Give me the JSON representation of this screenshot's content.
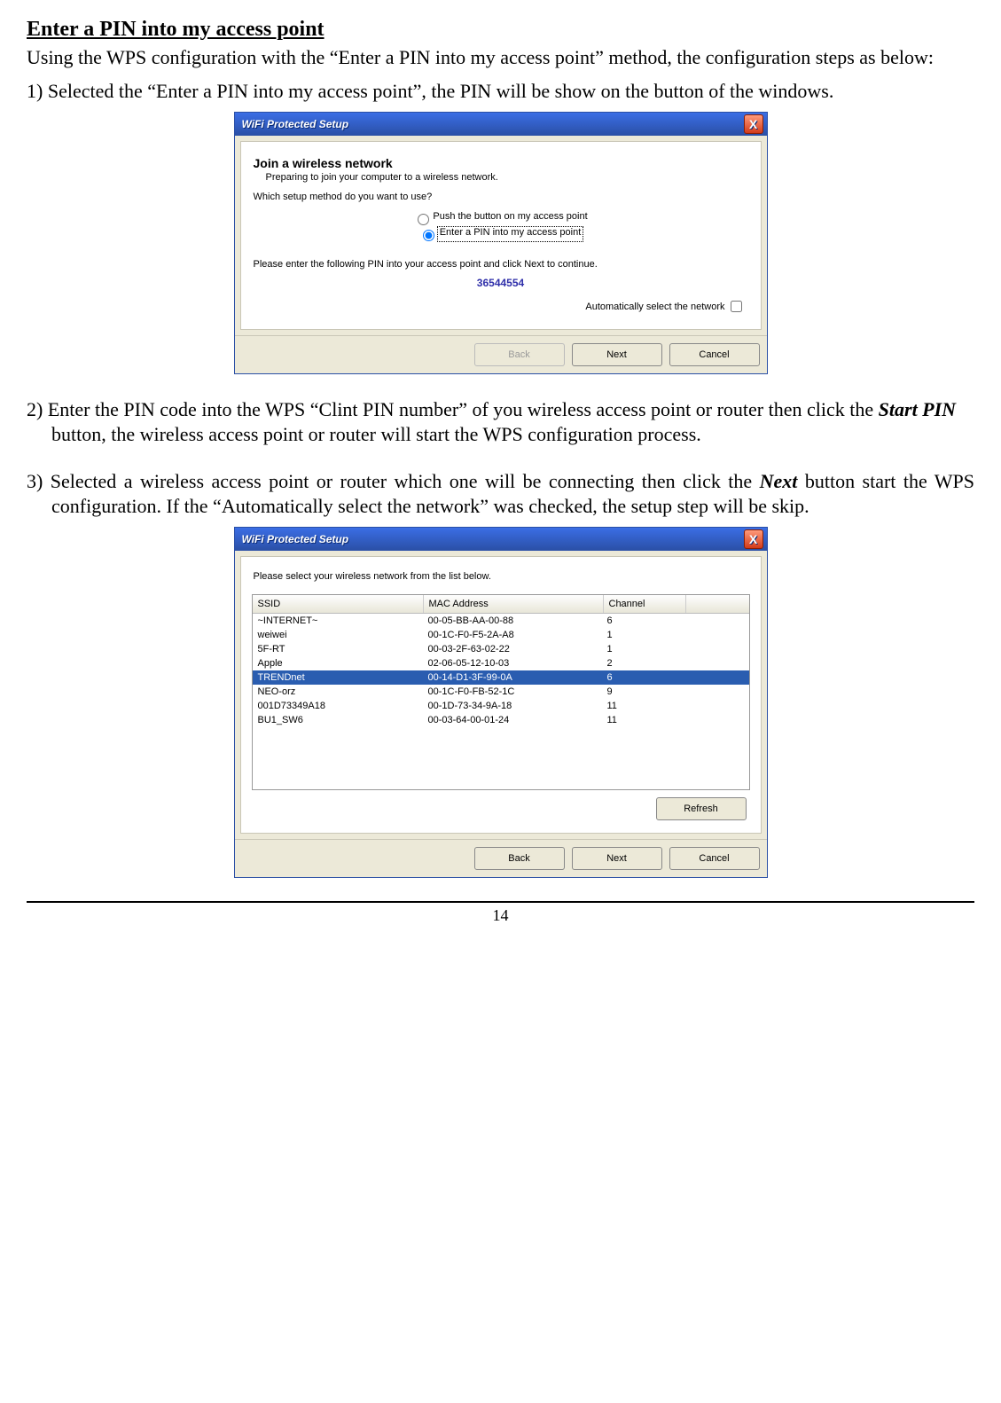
{
  "page": {
    "section_heading": "Enter a PIN into my access point",
    "intro": "Using the WPS configuration with the “Enter a PIN into my access point” method, the configuration steps as below:",
    "step1_num": "1) ",
    "step1": "Selected the “Enter a PIN into my access point”, the PIN will be show on the button of the windows.",
    "step2_num": "2) ",
    "step2_a": "Enter the PIN code into the WPS “Clint PIN number” of you wireless access point or router then click the  ",
    "step2_b": "Start PIN",
    "step2_c": " button, the wireless access point or router will start the WPS configuration process.",
    "step3_num": "3) ",
    "step3_a": "Selected a wireless access point or router which one will be connecting then click the ",
    "step3_b": "Next",
    "step3_c": " button start the WPS configuration. If the “Automatically select the network” was checked, the setup step will be skip.",
    "page_number": "14"
  },
  "dlg": {
    "title": "WiFi Protected Setup",
    "close": "X",
    "heading": "Join a wireless network",
    "sub": "Preparing to join your computer to a wireless network.",
    "method_prompt": "Which setup method do you want to use?",
    "radio1": "Push the button on my access point",
    "radio2": "Enter a PIN into my access point",
    "pin_prompt": "Please enter the following PIN into your access point and click Next to continue.",
    "pin_value": "36544554",
    "auto_select": "Automatically select the network",
    "back": "Back",
    "next": "Next",
    "cancel": "Cancel",
    "select_prompt": "Please select your wireless network from the list below.",
    "col_ssid": "SSID",
    "col_mac": "MAC Address",
    "col_ch": "Channel",
    "refresh": "Refresh"
  },
  "networks": [
    {
      "ssid": "~INTERNET~",
      "mac": "00-05-BB-AA-00-88",
      "ch": "6",
      "selected": false
    },
    {
      "ssid": "weiwei",
      "mac": "00-1C-F0-F5-2A-A8",
      "ch": "1",
      "selected": false
    },
    {
      "ssid": "5F-RT",
      "mac": "00-03-2F-63-02-22",
      "ch": "1",
      "selected": false
    },
    {
      "ssid": "Apple",
      "mac": "02-06-05-12-10-03",
      "ch": "2",
      "selected": false
    },
    {
      "ssid": "TRENDnet",
      "mac": "00-14-D1-3F-99-0A",
      "ch": "6",
      "selected": true
    },
    {
      "ssid": "NEO-orz",
      "mac": "00-1C-F0-FB-52-1C",
      "ch": "9",
      "selected": false
    },
    {
      "ssid": "001D73349A18",
      "mac": "00-1D-73-34-9A-18",
      "ch": "11",
      "selected": false
    },
    {
      "ssid": "BU1_SW6",
      "mac": "00-03-64-00-01-24",
      "ch": "11",
      "selected": false
    }
  ]
}
